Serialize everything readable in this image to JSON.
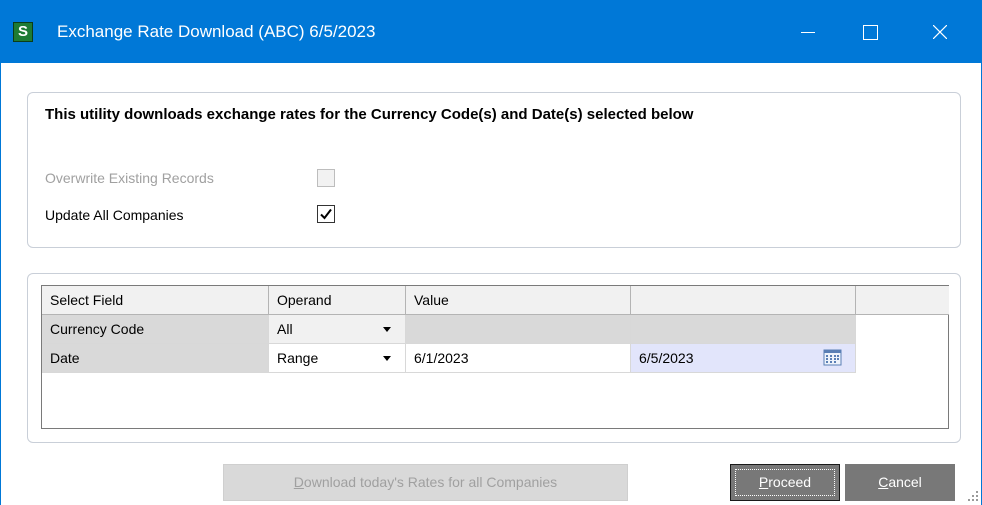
{
  "window": {
    "app_icon_letter": "S",
    "title": "Exchange Rate Download (ABC) 6/5/2023",
    "accent_color": "#0078d7"
  },
  "options": {
    "heading": "This utility downloads exchange rates for the Currency Code(s) and Date(s) selected below",
    "overwrite_label": "Overwrite Existing Records",
    "overwrite_checked": false,
    "overwrite_enabled": false,
    "update_all_label": "Update All Companies",
    "update_all_checked": true
  },
  "grid": {
    "columns": [
      "Select Field",
      "Operand",
      "Value",
      "",
      ""
    ],
    "rows": [
      {
        "field": "Currency Code",
        "operand": "All",
        "value": "",
        "value_to": ""
      },
      {
        "field": "Date",
        "operand": "Range",
        "value": "6/1/2023",
        "value_to": "6/5/2023"
      }
    ]
  },
  "buttons": {
    "download_prefix": "",
    "download_mnemonic": "D",
    "download_rest": "ownload today's Rates for all Companies",
    "proceed_mnemonic": "P",
    "proceed_rest": "roceed",
    "cancel_mnemonic": "C",
    "cancel_rest": "ancel"
  },
  "icons": {
    "minimize": "minimize-icon",
    "maximize": "maximize-icon",
    "close": "close-icon",
    "checkmark": "checkmark-icon",
    "dropdown": "chevron-down-icon",
    "calendar": "calendar-icon"
  }
}
